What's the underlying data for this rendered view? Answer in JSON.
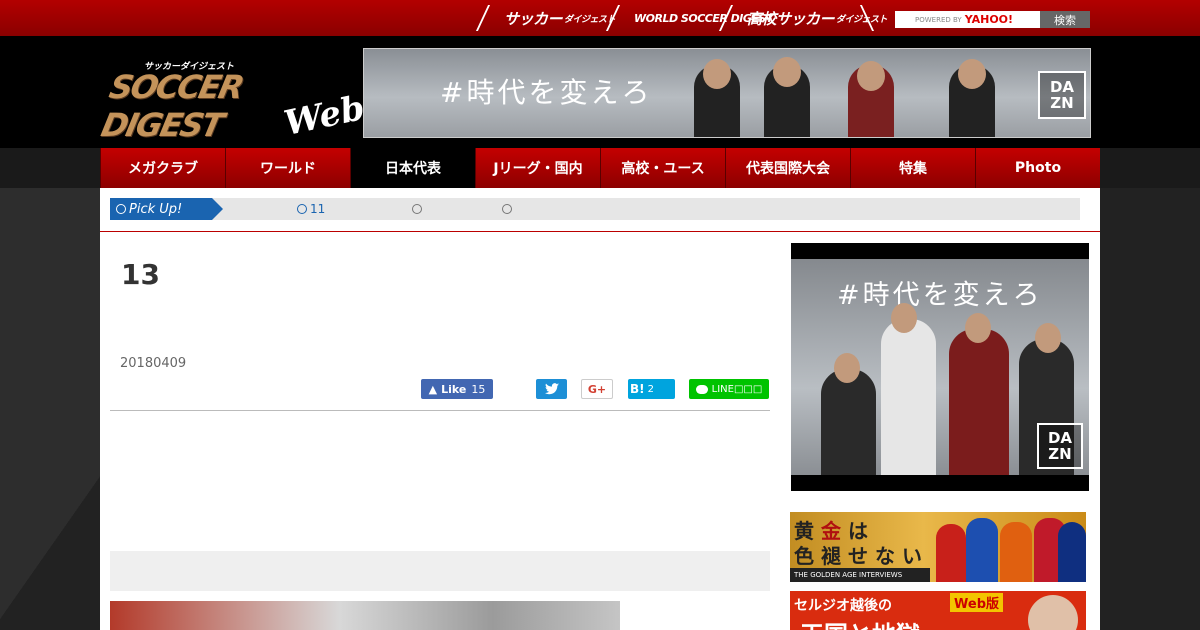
{
  "topbar": {
    "links": [
      {
        "label": "サッカー",
        "sub": "ダイジェスト"
      },
      {
        "label": "WORLD SOCCER DIGEST",
        "sub": ""
      },
      {
        "label": "高校サッカー",
        "sub": "ダイジェスト"
      }
    ],
    "search_powered": "POWERED BY",
    "search_brand": "YAHOO!",
    "search_button": "検索"
  },
  "logo": {
    "kana": "サッカーダイジェスト",
    "main": "SOCCER DIGEST",
    "web": "Web"
  },
  "banner": {
    "slogan": "#時代を変えろ",
    "brand_line1": "DA",
    "brand_line2": "ZN"
  },
  "nav": {
    "items": [
      {
        "label": "メガクラブ",
        "active": false
      },
      {
        "label": "ワールド",
        "active": false
      },
      {
        "label": "日本代表",
        "active": true
      },
      {
        "label": "Jリーグ・国内",
        "active": false
      },
      {
        "label": "高校・ユース",
        "active": false
      },
      {
        "label": "代表国際大会",
        "active": false
      },
      {
        "label": "特集",
        "active": false
      },
      {
        "label": "Photo",
        "active": false
      }
    ]
  },
  "pickup": {
    "label": "Pick Up!",
    "items": [
      "11",
      "",
      ""
    ]
  },
  "article": {
    "title": "13",
    "date": "20180409"
  },
  "share": {
    "facebook_label": "Like",
    "facebook_count": "15",
    "twitter_icon": "twitter-bird-icon",
    "gplus_label": "G+",
    "hatena_label": "B!",
    "hatena_count": "2",
    "line_label": "LINE□□□"
  },
  "sidebar": {
    "ad1_slogan": "#時代を変えろ",
    "ad1_brand_line1": "DA",
    "ad1_brand_line2": "ZN",
    "ad2_title_chars": [
      "黄",
      "金",
      "は",
      "色",
      "褪",
      "せ",
      "な",
      "い"
    ],
    "ad2_caption": "THE GOLDEN AGE INTERVIEWS",
    "ad3_title": "セルジオ越後の",
    "ad3_badge": "Web版",
    "ad3_sub": "天国と地獄"
  },
  "colors": {
    "brand_red": "#b30000",
    "pickup_blue": "#1a64b0",
    "facebook": "#4267b2",
    "twitter": "#1da1f2",
    "hatena": "#00a4de",
    "line": "#00c300"
  }
}
